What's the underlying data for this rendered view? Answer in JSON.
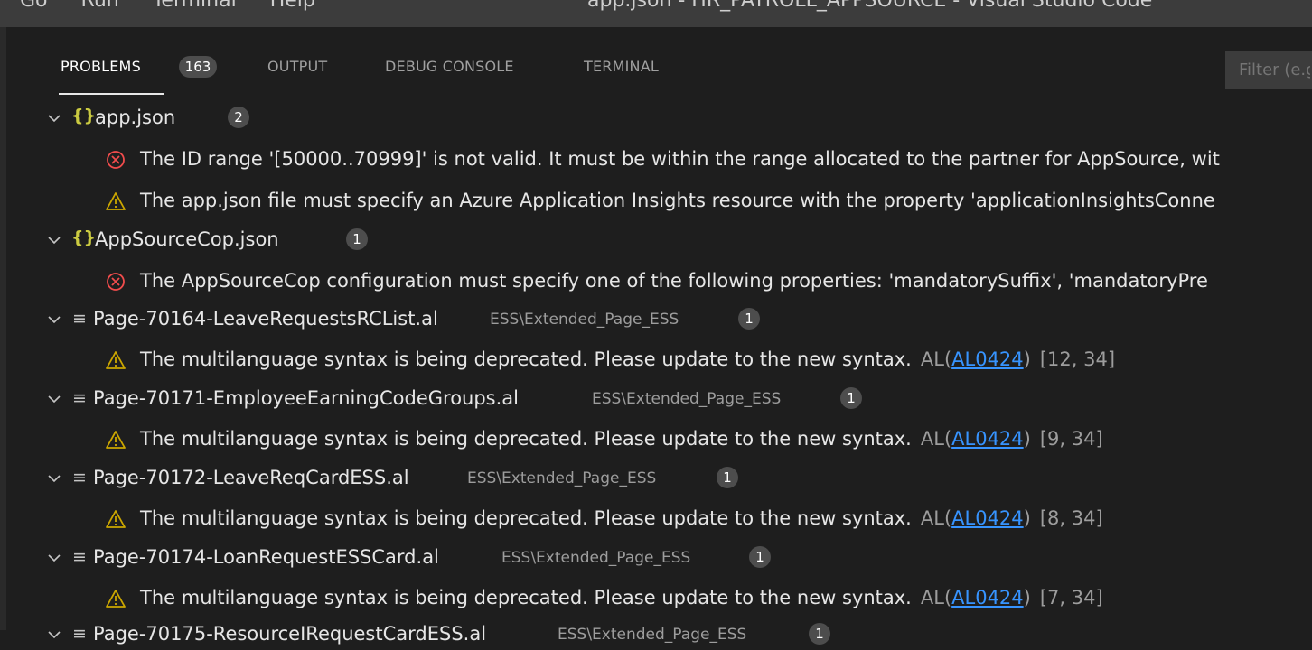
{
  "window": {
    "menu": [
      "Go",
      "Run",
      "Terminal",
      "Help"
    ],
    "title": "app.json - HR_PAYROLL_APPSOURCE - Visual Studio Code"
  },
  "panel": {
    "tabs": [
      {
        "label": "PROBLEMS",
        "badge": "163",
        "active": true
      },
      {
        "label": "OUTPUT"
      },
      {
        "label": "DEBUG CONSOLE"
      },
      {
        "label": "TERMINAL"
      }
    ],
    "filter_placeholder": "Filter (e.g. text, **/*.ts, !**/node_modules/**)"
  },
  "problems": {
    "groups": [
      {
        "icon": "json-braces-icon",
        "file": "app.json",
        "count": "2"
      },
      {
        "icon": "json-braces-icon",
        "file": "AppSourceCop.json",
        "count": "1"
      },
      {
        "icon": "al-file-icon",
        "file": "Page-70164-LeaveRequestsRCList.al",
        "path": "ESS\\Extended_Page_ESS",
        "count": "1"
      },
      {
        "icon": "al-file-icon",
        "file": "Page-70171-EmployeeEarningCodeGroups.al",
        "path": "ESS\\Extended_Page_ESS",
        "count": "1"
      },
      {
        "icon": "al-file-icon",
        "file": "Page-70172-LeaveReqCardESS.al",
        "path": "ESS\\Extended_Page_ESS",
        "count": "1"
      },
      {
        "icon": "al-file-icon",
        "file": "Page-70174-LoanRequestESSCard.al",
        "path": "ESS\\Extended_Page_ESS",
        "count": "1"
      }
    ],
    "items": [
      {
        "severity": "error",
        "message": "The ID range '[50000..70999]' is not valid. It must be within the range allocated to the partner for AppSource, wit"
      },
      {
        "severity": "warning",
        "message": "The app.json file must specify an Azure Application Insights resource with the property 'applicationInsightsConne"
      },
      {
        "severity": "error",
        "message": "The AppSourceCop configuration must specify one of the following properties: 'mandatorySuffix', 'mandatoryPre"
      },
      {
        "severity": "warning",
        "message": "The multilanguage syntax is being deprecated. Please update to the new syntax.",
        "source": "AL",
        "code": "AL0424",
        "location": "[12, 34]"
      },
      {
        "severity": "warning",
        "message": "The multilanguage syntax is being deprecated. Please update to the new syntax.",
        "source": "AL",
        "code": "AL0424",
        "location": "[9, 34]"
      },
      {
        "severity": "warning",
        "message": "The multilanguage syntax is being deprecated. Please update to the new syntax.",
        "source": "AL",
        "code": "AL0424",
        "location": "[8, 34]"
      },
      {
        "severity": "warning",
        "message": "The multilanguage syntax is being deprecated. Please update to the new syntax.",
        "source": "AL",
        "code": "AL0424",
        "location": "[7, 34]"
      }
    ],
    "partial_next_group": {
      "file": "Page-70175-ResourceIRequestCardESS.al",
      "path": "ESS\\Extended_Page_ESS",
      "count": "1"
    }
  },
  "colors": {
    "background": "#1e1e1e",
    "error": "#f14c4c",
    "warning": "#cca700",
    "link": "#3794ff",
    "json_icon": "#cbcb41"
  }
}
